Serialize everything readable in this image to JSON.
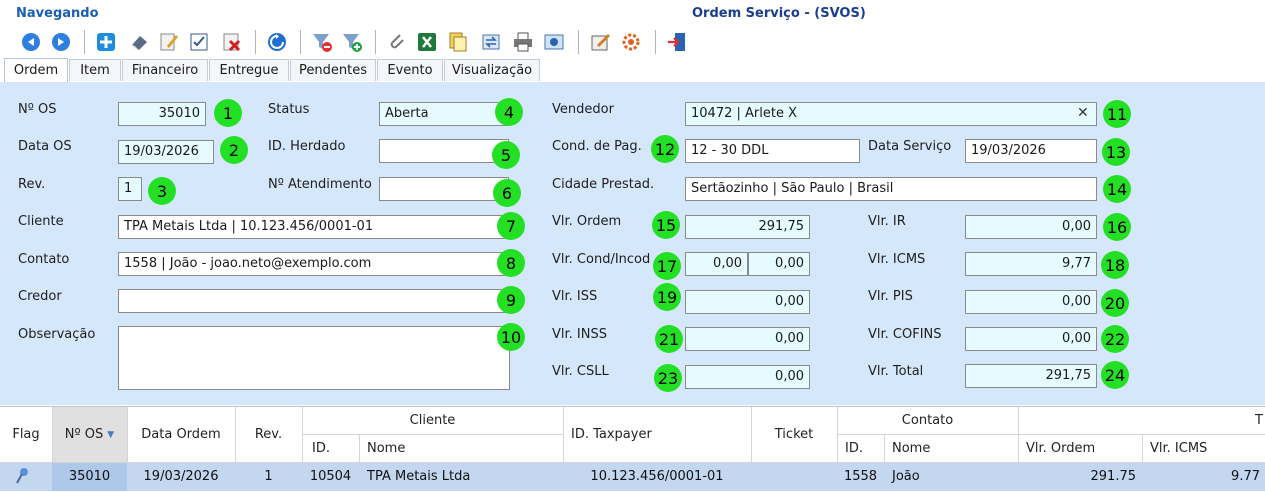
{
  "window": {
    "nav_label": "Navegando",
    "title": "Ordem Serviço - (SVOS)"
  },
  "toolbar": [
    {
      "name": "back-icon",
      "label": "back"
    },
    {
      "name": "forward-icon",
      "label": "forward"
    },
    {
      "name": "add-icon",
      "label": "add"
    },
    {
      "name": "eraser-icon",
      "label": "eraser"
    },
    {
      "name": "edit-icon",
      "label": "edit"
    },
    {
      "name": "checklist-icon",
      "label": "checklist"
    },
    {
      "name": "delete-icon",
      "label": "delete"
    },
    {
      "name": "refresh-icon",
      "label": "refresh"
    },
    {
      "name": "filter-clear-icon",
      "label": "filter clear"
    },
    {
      "name": "filter-add-icon",
      "label": "filter add"
    },
    {
      "name": "attach-icon",
      "label": "attach"
    },
    {
      "name": "excel-icon",
      "label": "excel"
    },
    {
      "name": "copy-icon",
      "label": "copy"
    },
    {
      "name": "transfer-icon",
      "label": "transfer"
    },
    {
      "name": "print-icon",
      "label": "print"
    },
    {
      "name": "preview-icon",
      "label": "preview"
    },
    {
      "name": "report-icon",
      "label": "report"
    },
    {
      "name": "settings-gear-icon",
      "label": "settings"
    },
    {
      "name": "exit-icon",
      "label": "exit"
    }
  ],
  "tabs": [
    "Ordem",
    "Item",
    "Financeiro",
    "Entregue",
    "Pendentes",
    "Evento",
    "Visualização"
  ],
  "form": {
    "nro_os": {
      "label": "Nº OS",
      "value": "35010",
      "badge": "1"
    },
    "data_os": {
      "label": "Data OS",
      "value": "19/03/2026",
      "badge": "2"
    },
    "rev": {
      "label": "Rev.",
      "value": "1",
      "badge": "3"
    },
    "status": {
      "label": "Status",
      "value": "Aberta",
      "badge": "4"
    },
    "id_herdado": {
      "label": "ID. Herdado",
      "value": "",
      "badge": "5"
    },
    "nro_atendimento": {
      "label": "Nº Atendimento",
      "value": "",
      "badge": "6"
    },
    "cliente": {
      "label": "Cliente",
      "value": "TPA Metais Ltda | 10.123.456/0001-01",
      "badge": "7"
    },
    "contato": {
      "label": "Contato",
      "value": "1558 | João - joao.neto@exemplo.com",
      "badge": "8"
    },
    "credor": {
      "label": "Credor",
      "value": "",
      "badge": "9"
    },
    "observacao": {
      "label": "Observação",
      "value": "",
      "badge": "10"
    },
    "vendedor": {
      "label": "Vendedor",
      "value": "10472 | Arlete X",
      "clear": "✕",
      "badge": "11"
    },
    "cond_pag": {
      "label": "Cond. de Pag.",
      "value": "12 - 30 DDL",
      "badge": "12"
    },
    "data_servico": {
      "label": "Data Serviço",
      "value": "19/03/2026",
      "badge": "13"
    },
    "cidade_prestad": {
      "label": "Cidade Prestad.",
      "value": "Sertãozinho | São Paulo | Brasil",
      "badge": "14"
    },
    "vlr_ordem": {
      "label": "Vlr. Ordem",
      "value": "291,75",
      "badge": "15"
    },
    "vlr_ir": {
      "label": "Vlr. IR",
      "value": "0,00",
      "badge": "16"
    },
    "vlr_cond_incod": {
      "label": "Vlr. Cond/Incod",
      "value1": "0,00",
      "value2": "0,00",
      "badge": "17"
    },
    "vlr_icms": {
      "label": "Vlr. ICMS",
      "value": "9,77",
      "badge": "18"
    },
    "vlr_iss": {
      "label": "Vlr. ISS",
      "value": "0,00",
      "badge": "19"
    },
    "vlr_pis": {
      "label": "Vlr. PIS",
      "value": "0,00",
      "badge": "20"
    },
    "vlr_inss": {
      "label": "Vlr. INSS",
      "value": "0,00",
      "badge": "21"
    },
    "vlr_cofins": {
      "label": "Vlr. COFINS",
      "value": "0,00",
      "badge": "22"
    },
    "vlr_csll": {
      "label": "Vlr. CSLL",
      "value": "0,00",
      "badge": "23"
    },
    "vlr_total": {
      "label": "Vlr. Total",
      "value": "291,75",
      "badge": "24"
    }
  },
  "grid": {
    "headers": {
      "flag": "Flag",
      "nro_os": "Nº OS",
      "data_ordem": "Data Ordem",
      "rev": "Rev.",
      "cliente": "Cliente",
      "cliente_id": "ID.",
      "cliente_nome": "Nome",
      "id_taxpayer": "ID. Taxpayer",
      "ticket": "Ticket",
      "contato": "Contato",
      "contato_id": "ID.",
      "contato_nome": "Nome",
      "group_t": "T",
      "vlr_ordem": "Vlr. Ordem",
      "vlr_icms": "Vlr. ICMS"
    },
    "rows": [
      {
        "nro_os": "35010",
        "data_ordem": "19/03/2026",
        "rev": "1",
        "cliente_id": "10504",
        "cliente_nome": "TPA Metais Ltda",
        "id_taxpayer": "10.123.456/0001-01",
        "ticket": "",
        "contato_id": "1558",
        "contato_nome": "João",
        "vlr_ordem": "291.75",
        "vlr_icms": "9.77"
      }
    ]
  }
}
